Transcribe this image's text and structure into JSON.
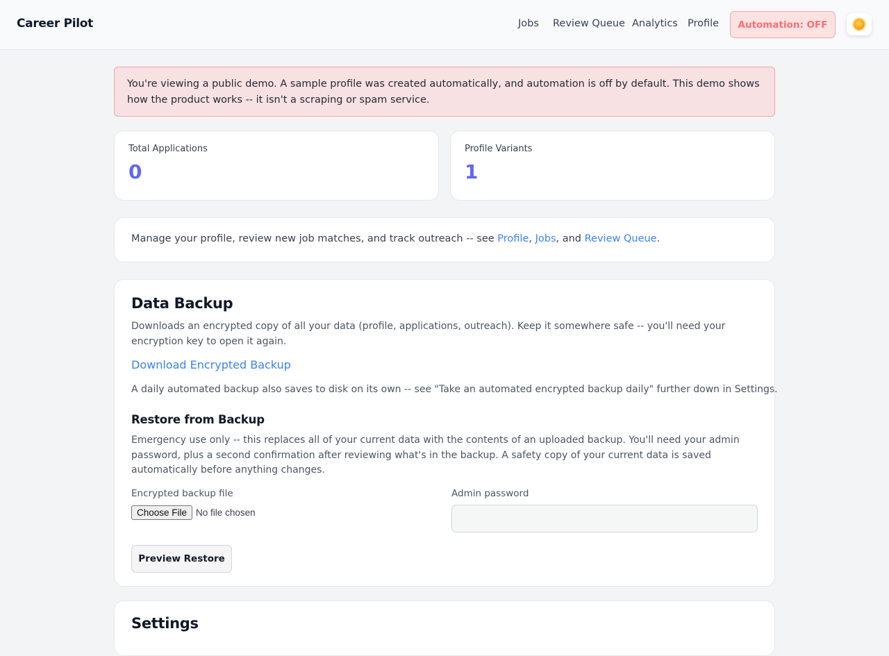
{
  "header": {
    "brand": "Career Pilot",
    "nav": {
      "jobs": "Jobs",
      "review_queue": "Review Queue",
      "analytics": "Analytics",
      "profile": "Profile"
    },
    "automation_button": "Automation: OFF",
    "theme_icon": "sun-icon"
  },
  "banner": {
    "text": "You're viewing a public demo. A sample profile was created automatically, and automation is off by default. This demo shows how the product works -- it isn't a scraping or spam service."
  },
  "stats": [
    {
      "label": "Total Applications",
      "value": "0"
    },
    {
      "label": "Profile Variants",
      "value": "1"
    }
  ],
  "intro": {
    "before": "Manage your profile, review new job matches, and track outreach -- see ",
    "link_profile": "Profile",
    "comma": ", ",
    "link_jobs": "Jobs",
    "and": ", and ",
    "link_review": "Review Queue",
    "end": "."
  },
  "backup": {
    "title": "Data Backup",
    "description": "Downloads an encrypted copy of all your data (profile, applications, outreach). Keep it somewhere safe -- you'll need your encryption key to open it again.",
    "download_link": "Download Encrypted Backup",
    "daily_note": "A daily automated backup also saves to disk on its own -- see \"Take an automated encrypted backup daily\" further down in Settings.",
    "restore": {
      "title": "Restore from Backup",
      "description": "Emergency use only -- this replaces all of your current data with the contents of an uploaded backup. You'll need your admin password, plus a second confirmation after reviewing what's in the backup. A safety copy of your current data is saved automatically before anything changes.",
      "file_label": "Encrypted backup file",
      "choose_file": "Choose File",
      "no_file": "No file chosen",
      "password_label": "Admin password",
      "password_value": "",
      "preview_button": "Preview Restore"
    }
  },
  "settings": {
    "title": "Settings"
  },
  "colors": {
    "accent": "#6366f1",
    "link": "#3b82f6",
    "banner_bg": "#f8e1e3",
    "automation_text": "#f87171"
  }
}
